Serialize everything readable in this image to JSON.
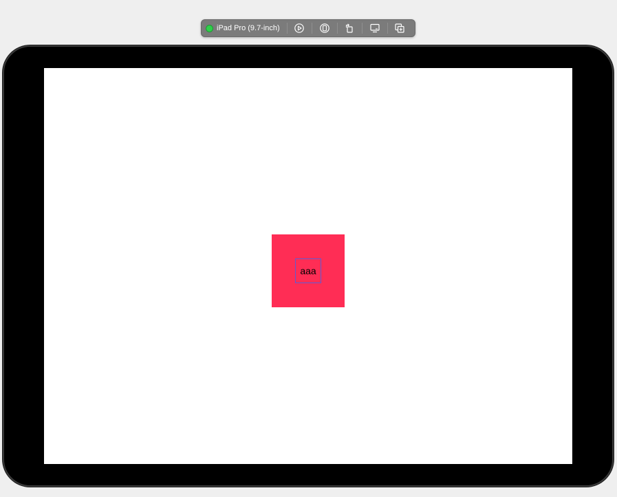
{
  "toolbar": {
    "device_name": "iPad Pro (9.7-inch)",
    "status_color": "#2fd04a",
    "buttons": [
      {
        "icon": "live-preview-icon"
      },
      {
        "icon": "preview-icon"
      },
      {
        "icon": "rotate-device-icon"
      },
      {
        "icon": "device-settings-icon"
      },
      {
        "icon": "duplicate-preview-icon"
      }
    ]
  },
  "canvas": {
    "square_color": "#ff2d55",
    "label_text": "aaa",
    "label_border_color": "#5b5bd6"
  }
}
